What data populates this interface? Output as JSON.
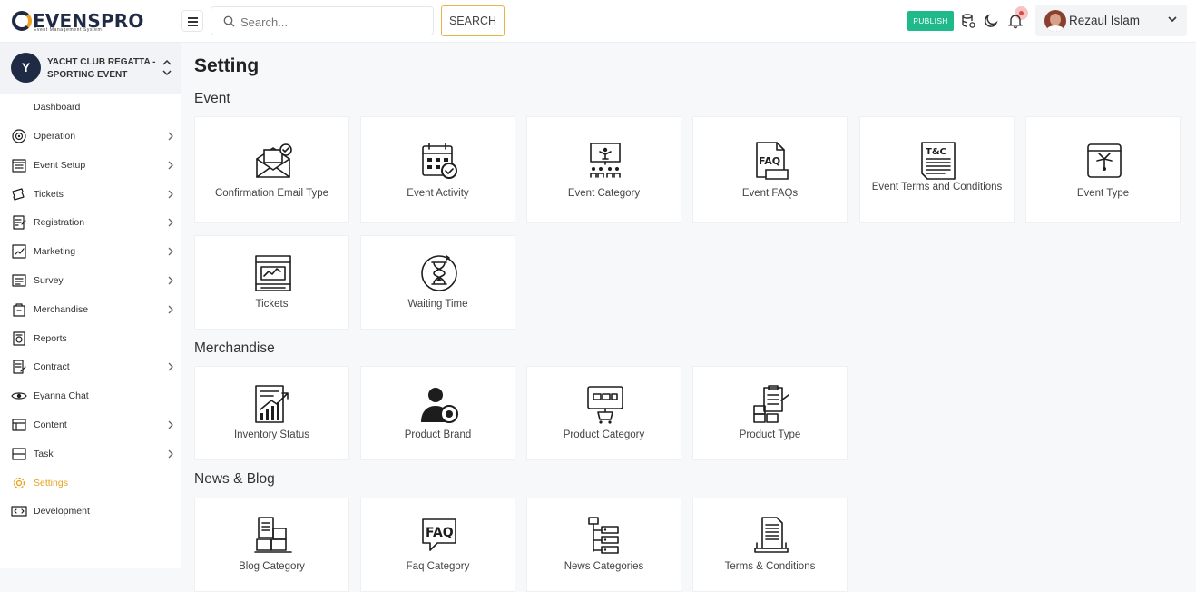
{
  "header": {
    "logo_text": "EVENSPRO",
    "logo_tagline": "Event Management System",
    "search_placeholder": "Search...",
    "search_button": "SEARCH",
    "publish_button": "PUBLISH",
    "user_name": "Rezaul Islam",
    "icons": [
      "menu-icon",
      "search-icon",
      "database-icon",
      "moon-icon",
      "bell-icon",
      "chevron-down-icon"
    ]
  },
  "sidebar": {
    "project_initial": "Y",
    "project_name": "YACHT CLUB REGATTA - SPORTING EVENT",
    "dashboard_label": "Dashboard",
    "items": [
      {
        "label": "Operation",
        "icon": "gear-dots-icon",
        "has_chevron": true
      },
      {
        "label": "Event Setup",
        "icon": "calendar-grid-icon",
        "has_chevron": true
      },
      {
        "label": "Tickets",
        "icon": "tickets-icon",
        "has_chevron": true
      },
      {
        "label": "Registration",
        "icon": "registration-icon",
        "has_chevron": true
      },
      {
        "label": "Marketing",
        "icon": "marketing-icon",
        "has_chevron": true
      },
      {
        "label": "Survey",
        "icon": "survey-icon",
        "has_chevron": true
      },
      {
        "label": "Merchandise",
        "icon": "bag-icon",
        "has_chevron": true
      },
      {
        "label": "Reports",
        "icon": "reports-icon",
        "has_chevron": false
      },
      {
        "label": "Contract",
        "icon": "contract-icon",
        "has_chevron": true
      },
      {
        "label": "Eyanna Chat",
        "icon": "eye-chat-icon",
        "has_chevron": false
      },
      {
        "label": "Content",
        "icon": "content-icon",
        "has_chevron": true
      },
      {
        "label": "Task",
        "icon": "task-icon",
        "has_chevron": true
      },
      {
        "label": "Settings",
        "icon": "settings-gear-icon",
        "has_chevron": false,
        "active": true
      },
      {
        "label": "Development",
        "icon": "development-icon",
        "has_chevron": false
      }
    ],
    "active_color": "#e7a21c"
  },
  "main": {
    "title": "Setting",
    "sections": [
      {
        "title": "Event",
        "cards": [
          {
            "label": "Confirmation Email Type",
            "icon": "email-check-icon"
          },
          {
            "label": "Event Activity",
            "icon": "calendar-check-icon"
          },
          {
            "label": "Event Category",
            "icon": "presentation-audience-icon"
          },
          {
            "label": "Event FAQs",
            "icon": "faq-document-icon"
          },
          {
            "label": "Event Terms and Conditions",
            "icon": "terms-document-icon"
          },
          {
            "label": "Event Type",
            "icon": "calendar-fireworks-icon"
          },
          {
            "label": "Tickets",
            "icon": "ticket-chart-icon"
          },
          {
            "label": "Waiting Time",
            "icon": "hourglass-icon"
          }
        ]
      },
      {
        "title": "Merchandise",
        "cards": [
          {
            "label": "Inventory Status",
            "icon": "inventory-chart-icon"
          },
          {
            "label": "Product Brand",
            "icon": "person-badge-icon"
          },
          {
            "label": "Product Category",
            "icon": "category-cart-icon"
          },
          {
            "label": "Product Type",
            "icon": "clipboard-boxes-icon"
          }
        ]
      },
      {
        "title": "News & Blog",
        "cards": [
          {
            "label": "Blog Category",
            "icon": "blog-boxes-icon"
          },
          {
            "label": "Faq Category",
            "icon": "faq-bubble-icon"
          },
          {
            "label": "News Categories",
            "icon": "hierarchy-list-icon"
          },
          {
            "label": "Terms & Conditions",
            "icon": "laptop-document-icon"
          }
        ]
      }
    ]
  },
  "colors": {
    "publish": "#20b98a",
    "search_border": "#e7b248",
    "brand_dark": "#1f2a44"
  }
}
